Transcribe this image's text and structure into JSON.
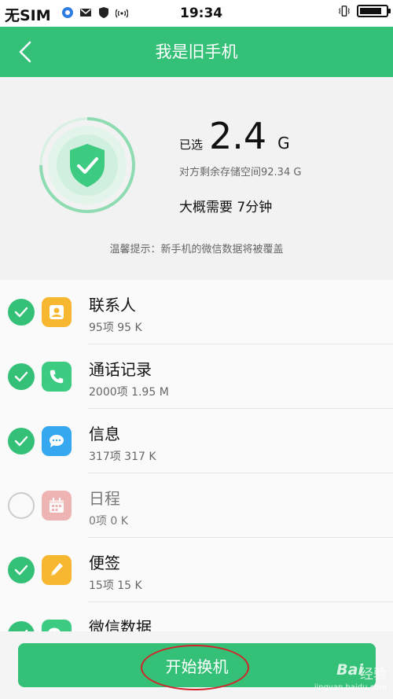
{
  "status_bar": {
    "sim_text": "无SIM",
    "time": "19:34",
    "icons": [
      "baidu-app-icon",
      "mail-icon",
      "shield-icon",
      "wifi-hotspot-icon",
      "vibrate-icon",
      "battery-icon"
    ],
    "battery_level": 0.85
  },
  "header": {
    "title": "我是旧手机",
    "back_icon": "chevron-left-icon"
  },
  "summary": {
    "selected_label": "已选",
    "selected_size": "2.4",
    "selected_unit": "G",
    "remaining_storage": "对方剩余存储空间92.34 G",
    "estimated_time": "大概需要 7分钟",
    "tip": "温馨提示：新手机的微信数据将被覆盖"
  },
  "items": [
    {
      "title": "联系人",
      "subtitle": "95项 95 K",
      "checked": true,
      "icon": "contacts-icon",
      "icon_color": "#f7b731"
    },
    {
      "title": "通话记录",
      "subtitle": "2000项 1.95 M",
      "checked": true,
      "icon": "phone-icon",
      "icon_color": "#3ccb80"
    },
    {
      "title": "信息",
      "subtitle": "317项 317 K",
      "checked": true,
      "icon": "message-icon",
      "icon_color": "#35a8ef"
    },
    {
      "title": "日程",
      "subtitle": "0项 0 K",
      "checked": false,
      "icon": "calendar-icon",
      "icon_color": "#e0605e"
    },
    {
      "title": "便签",
      "subtitle": "15项 15 K",
      "checked": true,
      "icon": "note-icon",
      "icon_color": "#f7b731"
    },
    {
      "title": "微信数据",
      "subtitle": "",
      "checked": true,
      "icon": "wechat-icon",
      "icon_color": "#3ccb80"
    }
  ],
  "bottom": {
    "start_button": "开始换机"
  },
  "watermark": {
    "brand": "Bai",
    "brand_suffix": "经验",
    "url": "jingyan.baidu.com"
  },
  "colors": {
    "accent": "#34c077",
    "annotation": "#d2232a"
  }
}
